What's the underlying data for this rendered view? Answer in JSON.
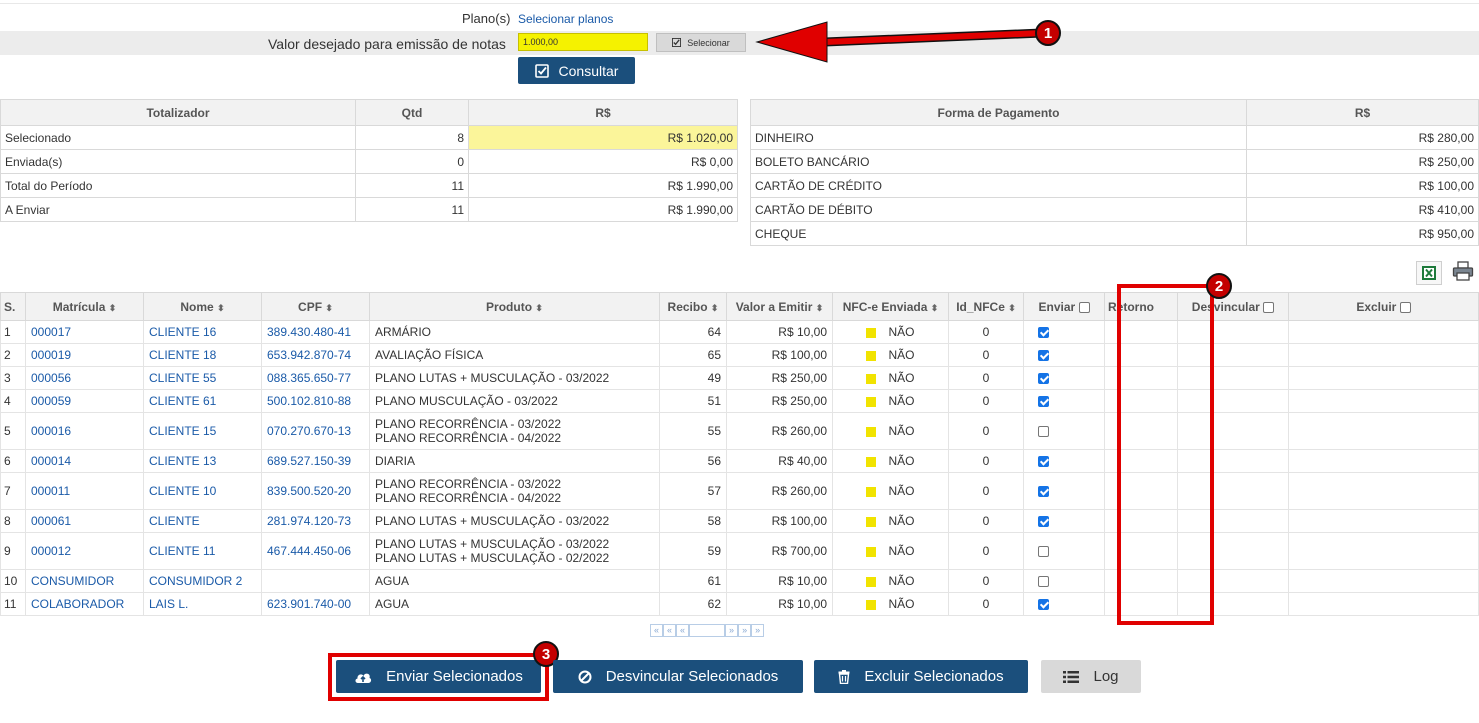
{
  "filter": {
    "plans_label": "Plano(s)",
    "plans_link": "Selecionar planos",
    "valor_label": "Valor desejado para emissão de notas",
    "valor_value": "1.000,00",
    "select_button": "Selecionar",
    "consultar_button": "Consultar"
  },
  "totalizador": {
    "headers": [
      "Totalizador",
      "Qtd",
      "R$"
    ],
    "rows": [
      {
        "label": "Selecionado",
        "qtd": "8",
        "valor": "R$ 1.020,00"
      },
      {
        "label": "Enviada(s)",
        "qtd": "0",
        "valor": "R$ 0,00"
      },
      {
        "label": "Total do Período",
        "qtd": "11",
        "valor": "R$ 1.990,00"
      },
      {
        "label": "A Enviar",
        "qtd": "11",
        "valor": "R$ 1.990,00"
      }
    ]
  },
  "pagamento": {
    "headers": [
      "Forma de Pagamento",
      "R$"
    ],
    "rows": [
      {
        "forma": "DINHEIRO",
        "valor": "R$ 280,00"
      },
      {
        "forma": "BOLETO BANCÁRIO",
        "valor": "R$ 250,00"
      },
      {
        "forma": "CARTÃO DE CRÉDITO",
        "valor": "R$ 100,00"
      },
      {
        "forma": "CARTÃO DE DÉBITO",
        "valor": "R$ 410,00"
      },
      {
        "forma": "CHEQUE",
        "valor": "R$ 950,00"
      }
    ]
  },
  "table": {
    "headers": {
      "s": "S.",
      "matricula": "Matrícula",
      "nome": "Nome",
      "cpf": "CPF",
      "produto": "Produto",
      "recibo": "Recibo",
      "valor": "Valor a Emitir",
      "nfce": "NFC-e Enviada",
      "id_nfce": "Id_NFCe",
      "enviar": "Enviar",
      "retorno": "Retorno",
      "desvincular": "Desvincular",
      "excluir": "Excluir"
    },
    "sort_glyph": "⬍",
    "rows": [
      {
        "s": "1",
        "matricula": "000017",
        "nome": "CLIENTE 16",
        "cpf": "389.430.480-41",
        "produto": [
          "ARMÁRIO"
        ],
        "recibo": "64",
        "valor": "R$ 10,00",
        "nfce": "NÃO",
        "id_nfce": "0",
        "enviar": true
      },
      {
        "s": "2",
        "matricula": "000019",
        "nome": "CLIENTE 18",
        "cpf": "653.942.870-74",
        "produto": [
          "AVALIAÇÃO FÍSICA"
        ],
        "recibo": "65",
        "valor": "R$ 100,00",
        "nfce": "NÃO",
        "id_nfce": "0",
        "enviar": true
      },
      {
        "s": "3",
        "matricula": "000056",
        "nome": "CLIENTE 55",
        "cpf": "088.365.650-77",
        "produto": [
          "PLANO LUTAS + MUSCULAÇÃO - 03/2022"
        ],
        "recibo": "49",
        "valor": "R$ 250,00",
        "nfce": "NÃO",
        "id_nfce": "0",
        "enviar": true
      },
      {
        "s": "4",
        "matricula": "000059",
        "nome": "CLIENTE 61",
        "cpf": "500.102.810-88",
        "produto": [
          "PLANO MUSCULAÇÃO - 03/2022"
        ],
        "recibo": "51",
        "valor": "R$ 250,00",
        "nfce": "NÃO",
        "id_nfce": "0",
        "enviar": true
      },
      {
        "s": "5",
        "matricula": "000016",
        "nome": "CLIENTE 15",
        "cpf": "070.270.670-13",
        "produto": [
          "PLANO RECORRÊNCIA - 03/2022",
          "PLANO RECORRÊNCIA - 04/2022"
        ],
        "recibo": "55",
        "valor": "R$ 260,00",
        "nfce": "NÃO",
        "id_nfce": "0",
        "enviar": false
      },
      {
        "s": "6",
        "matricula": "000014",
        "nome": "CLIENTE 13",
        "cpf": "689.527.150-39",
        "produto": [
          "DIARIA"
        ],
        "recibo": "56",
        "valor": "R$ 40,00",
        "nfce": "NÃO",
        "id_nfce": "0",
        "enviar": true
      },
      {
        "s": "7",
        "matricula": "000011",
        "nome": "CLIENTE 10",
        "cpf": "839.500.520-20",
        "produto": [
          "PLANO RECORRÊNCIA - 03/2022",
          "PLANO RECORRÊNCIA - 04/2022"
        ],
        "recibo": "57",
        "valor": "R$ 260,00",
        "nfce": "NÃO",
        "id_nfce": "0",
        "enviar": true
      },
      {
        "s": "8",
        "matricula": "000061",
        "nome": "CLIENTE",
        "cpf": "281.974.120-73",
        "produto": [
          "PLANO LUTAS + MUSCULAÇÃO - 03/2022"
        ],
        "recibo": "58",
        "valor": "R$ 100,00",
        "nfce": "NÃO",
        "id_nfce": "0",
        "enviar": true
      },
      {
        "s": "9",
        "matricula": "000012",
        "nome": "CLIENTE 11",
        "cpf": "467.444.450-06",
        "produto": [
          "PLANO LUTAS + MUSCULAÇÃO - 03/2022",
          "PLANO LUTAS + MUSCULAÇÃO - 02/2022"
        ],
        "recibo": "59",
        "valor": "R$ 700,00",
        "nfce": "NÃO",
        "id_nfce": "0",
        "enviar": false
      },
      {
        "s": "10",
        "matricula": "CONSUMIDOR",
        "nome": "CONSUMIDOR 2",
        "cpf": "",
        "produto": [
          "AGUA"
        ],
        "recibo": "61",
        "valor": "R$ 10,00",
        "nfce": "NÃO",
        "id_nfce": "0",
        "enviar": false
      },
      {
        "s": "11",
        "matricula": "COLABORADOR",
        "nome": "LAIS L.",
        "cpf": "623.901.740-00",
        "produto": [
          "AGUA"
        ],
        "recibo": "62",
        "valor": "R$ 10,00",
        "nfce": "NÃO",
        "id_nfce": "0",
        "enviar": true
      }
    ]
  },
  "pager": [
    "«",
    "«",
    "«",
    "",
    "»",
    "»",
    "»"
  ],
  "actions": {
    "enviar": "Enviar Selecionados",
    "desvincular": "Desvincular Selecionados",
    "excluir": "Excluir Selecionados",
    "log": "Log"
  },
  "annotations": [
    "1",
    "2",
    "3"
  ],
  "colors": {
    "navy": "#1b4f7c",
    "highlight": "#fbf59a",
    "annotation_red": "#e00000",
    "link": "#1a5aa8"
  }
}
